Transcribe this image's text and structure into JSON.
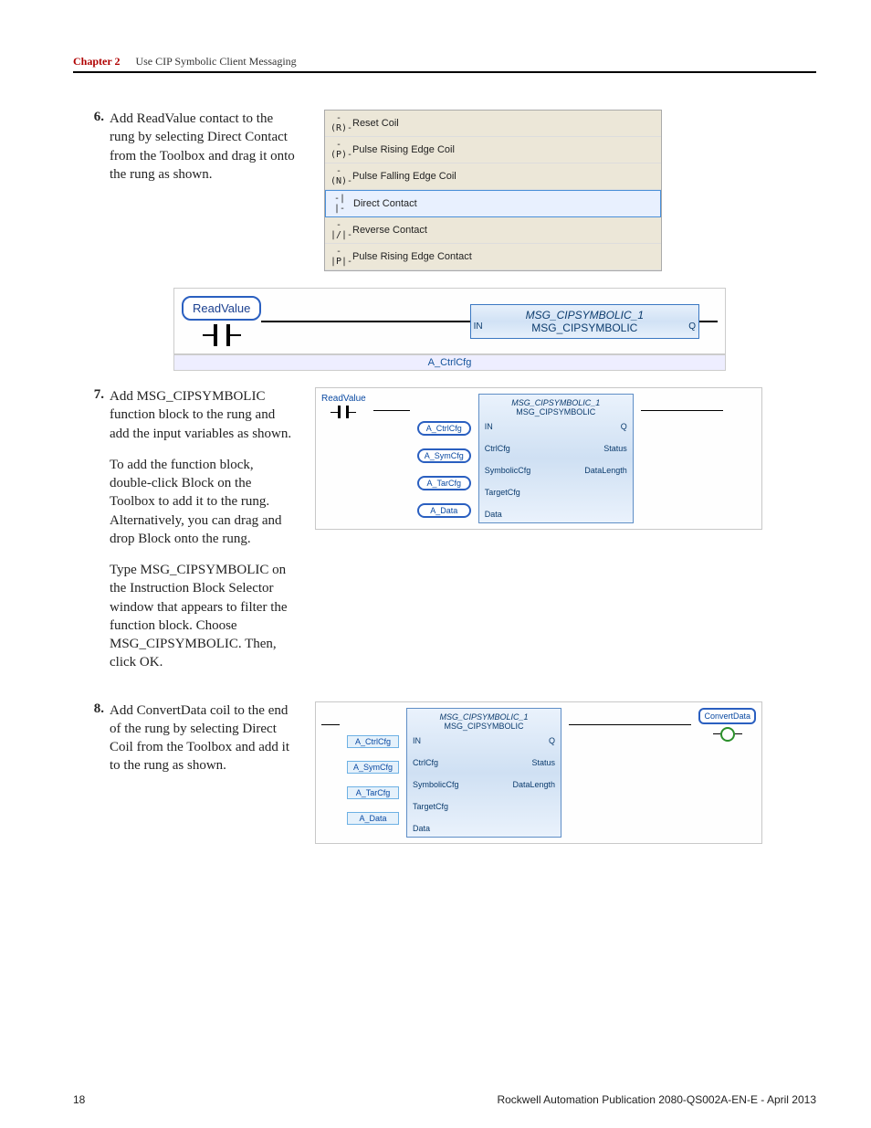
{
  "header": {
    "chapter_label": "Chapter 2",
    "chapter_title": "Use CIP Symbolic Client Messaging"
  },
  "steps": [
    {
      "num": "6.",
      "text": "Add ReadValue contact to the rung by selecting Direct Contact from the Toolbox and drag it onto the  rung as shown."
    },
    {
      "num": "7.",
      "paragraphs": [
        "Add MSG_CIPSYMBOLIC function block to the rung and add the input variables as shown.",
        "To add the function block, double-click Block on the Toolbox to add it to the rung. Alternatively, you can drag and drop Block onto the rung.",
        "Type MSG_CIPSYMBOLIC on the Instruction Block Selector window that appears to filter the function block. Choose MSG_CIPSYMBOLIC. Then, click OK."
      ]
    },
    {
      "num": "8.",
      "text": "Add ConvertData coil to the end of the rung by selecting Direct Coil from the Toolbox and add it to the rung as shown."
    }
  ],
  "toolbox_items": [
    "Reset Coil",
    "Pulse Rising Edge Coil",
    "Pulse Falling Edge Coil",
    "Direct Contact",
    "Reverse Contact",
    "Pulse Rising Edge Contact"
  ],
  "toolbox_selected_index": 3,
  "rung1": {
    "contact_label": "ReadValue",
    "block_instance": "MSG_CIPSYMBOLIC_1",
    "block_type": "MSG_CIPSYMBOLIC",
    "port_in": "IN",
    "port_q": "Q",
    "bar_label": "A_CtrlCfg"
  },
  "fb": {
    "instance": "MSG_CIPSYMBOLIC_1",
    "type": "MSG_CIPSYMBOLIC",
    "left_ports": [
      "IN",
      "CtrlCfg",
      "SymbolicCfg",
      "TargetCfg",
      "Data"
    ],
    "right_ports": [
      "Q",
      "Status",
      "DataLength"
    ],
    "left_vars": [
      "A_CtrlCfg",
      "A_SymCfg",
      "A_TarCfg",
      "A_Data"
    ]
  },
  "rung7": {
    "contact_label": "ReadValue"
  },
  "rung8": {
    "coil_label": "ConvertData"
  },
  "footer": {
    "page": "18",
    "pub": "Rockwell Automation Publication 2080-QS002A-EN-E - April 2013"
  }
}
